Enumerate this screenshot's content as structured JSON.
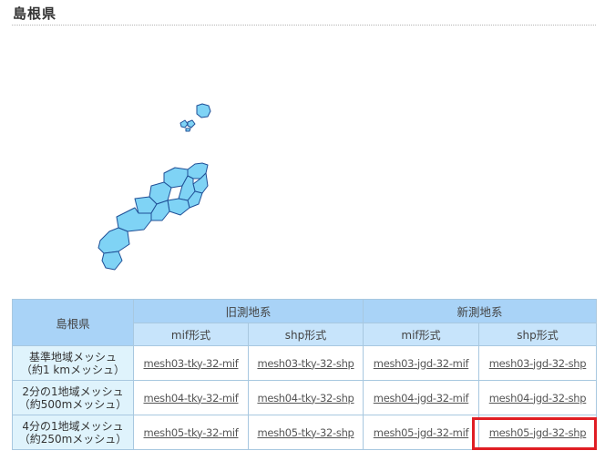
{
  "page": {
    "title": "島根県"
  },
  "table": {
    "corner": "島根県",
    "groups": {
      "old": "旧測地系",
      "new": "新測地系"
    },
    "formats": [
      "mif形式",
      "shp形式",
      "mif形式",
      "shp形式"
    ],
    "rows": [
      {
        "label_line1": "基準地域メッシュ",
        "label_line2": "（約1 kmメッシュ）",
        "links": [
          "mesh03-tky-32-mif",
          "mesh03-tky-32-shp",
          "mesh03-jgd-32-mif",
          "mesh03-jgd-32-shp"
        ]
      },
      {
        "label_line1": "2分の1地域メッシュ",
        "label_line2": "（約500mメッシュ）",
        "links": [
          "mesh04-tky-32-mif",
          "mesh04-tky-32-shp",
          "mesh04-jgd-32-mif",
          "mesh04-jgd-32-shp"
        ]
      },
      {
        "label_line1": "4分の1地域メッシュ",
        "label_line2": "（約250mメッシュ）",
        "links": [
          "mesh05-tky-32-mif",
          "mesh05-tky-32-shp",
          "mesh05-jgd-32-mif",
          "mesh05-jgd-32-shp"
        ]
      }
    ]
  },
  "colors": {
    "map_fill": "#7fd3f5",
    "map_stroke": "#1f4f96",
    "highlight": "#e01e24",
    "header_bg": "#a9d3f7",
    "rowhead_bg": "#dff3fc"
  }
}
